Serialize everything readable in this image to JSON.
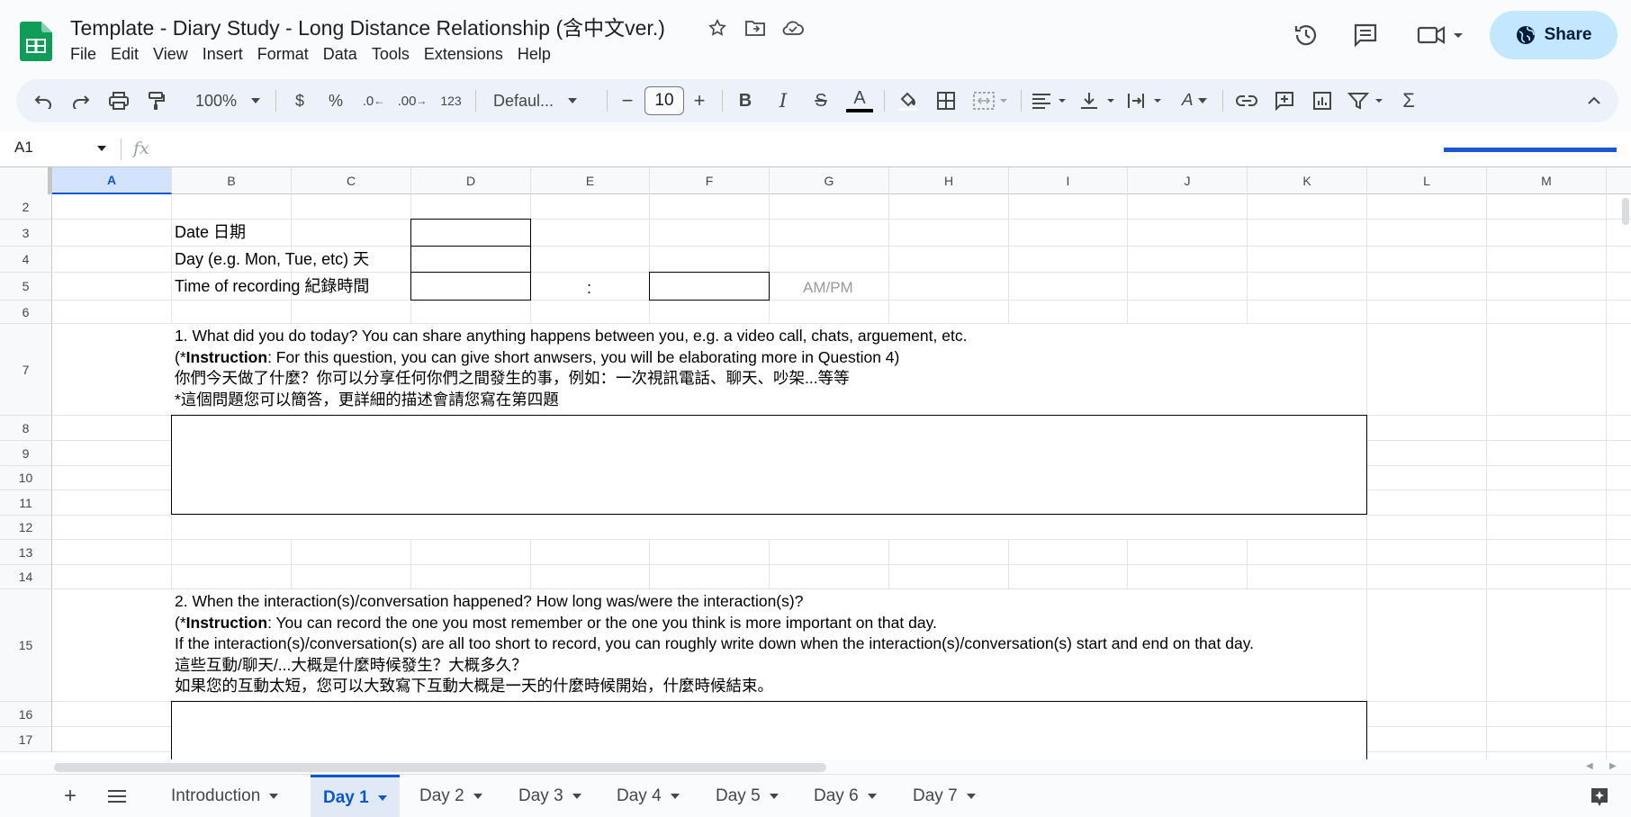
{
  "app": {
    "title": "Template - Diary Study - Long Distance Relationship (含中文ver.)",
    "share_label": "Share"
  },
  "menu": [
    "File",
    "Edit",
    "View",
    "Insert",
    "Format",
    "Data",
    "Tools",
    "Extensions",
    "Help"
  ],
  "toolbar": {
    "zoom": "100%",
    "currency": "$",
    "percent": "%",
    "dec_decrease": ".0",
    "dec_increase": ".00",
    "number_format": "123",
    "font": "Defaul...",
    "font_size": "10",
    "bold": "B",
    "italic": "I",
    "strike": "S",
    "text_color": "A",
    "text_rotate": "A"
  },
  "formula_bar": {
    "name_box": "A1",
    "fx": "fx"
  },
  "columns": [
    "A",
    "B",
    "C",
    "D",
    "E",
    "F",
    "G",
    "H",
    "I",
    "J",
    "K",
    "L",
    "M"
  ],
  "rows": [
    "2",
    "3",
    "4",
    "5",
    "6",
    "7",
    "8",
    "9",
    "10",
    "11",
    "12",
    "13",
    "14",
    "15",
    "16",
    "17"
  ],
  "cells": {
    "date_label": "Date 日期",
    "day_label": "Day (e.g. Mon, Tue, etc) 天",
    "time_label": "Time of recording 紀錄時間",
    "colon": ":",
    "ampm": "AM/PM",
    "q1_line1": "1. What did you do today? You can share anything happens between you, e.g. a video call, chats, arguement, etc.",
    "q1_line2_prefix": "(*",
    "q1_line2_bold": "Instruction",
    "q1_line2_rest": ": For this question, you can give short anwsers, you will be elaborating more in Question 4)",
    "q1_line3": "你們今天做了什麼？你可以分享任何你們之間發生的事，例如：一次視訊電話、聊天、吵架...等等",
    "q1_line4": "*這個問題您可以簡答，更詳細的描述會請您寫在第四題",
    "q2_line1": "2. When the interaction(s)/conversation happened? How long was/were the interaction(s)?",
    "q2_line2_prefix": "(*",
    "q2_line2_bold": "Instruction",
    "q2_line2_rest": ": You can record the one you most remember or the one you think is more important on that day.",
    "q2_line3": "If the interaction(s)/conversation(s) are all too short to record, you can roughly write down when the interaction(s)/conversation(s) start and end on that day.",
    "q2_line4": "這些互動/聊天/...大概是什麼時候發生？大概多久？",
    "q2_line5": "如果您的互動太短，您可以大致寫下互動大概是一天的什麼時候開始，什麼時候結束。"
  },
  "sheets": [
    "Introduction",
    "Day 1",
    "Day 2",
    "Day 3",
    "Day 4",
    "Day 5",
    "Day 6",
    "Day 7"
  ],
  "active_sheet": "Day 1",
  "colors": {
    "accent": "#0b57d0",
    "share_bg": "#c2e7ff",
    "logo_green": "#0f9d58"
  }
}
